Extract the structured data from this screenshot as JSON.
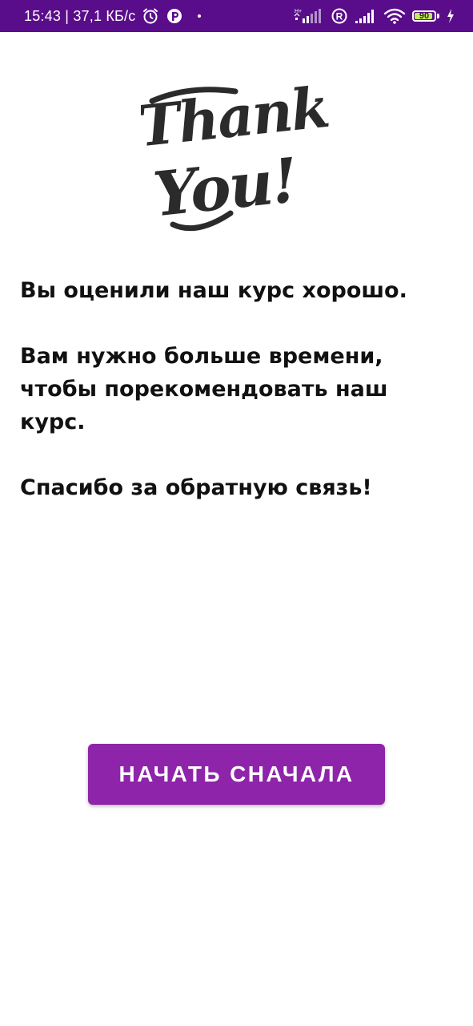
{
  "status_bar": {
    "time_speed": "15:43 | 37,1 КБ/с",
    "battery_level": "90",
    "battery_percent": 90,
    "icons": [
      "alarm-icon",
      "app-notification-icon",
      "notification-dot-icon",
      "signal-h-plus-icon",
      "registered-icon",
      "signal-bars-icon",
      "wifi-icon",
      "battery-icon",
      "charging-icon"
    ],
    "background_color": "#5a0d8a"
  },
  "logo": {
    "text_line1": "Thank",
    "text_line2": "You!"
  },
  "message": {
    "line1": "Вы оценили наш курс хорошо.",
    "line2": "Вам нужно больше времени, чтобы порекомендовать наш курс.",
    "line3": "Спасибо за обратную связь!"
  },
  "restart_button": {
    "label": "НАЧАТЬ СНАЧАЛА",
    "color": "#8e24aa"
  }
}
